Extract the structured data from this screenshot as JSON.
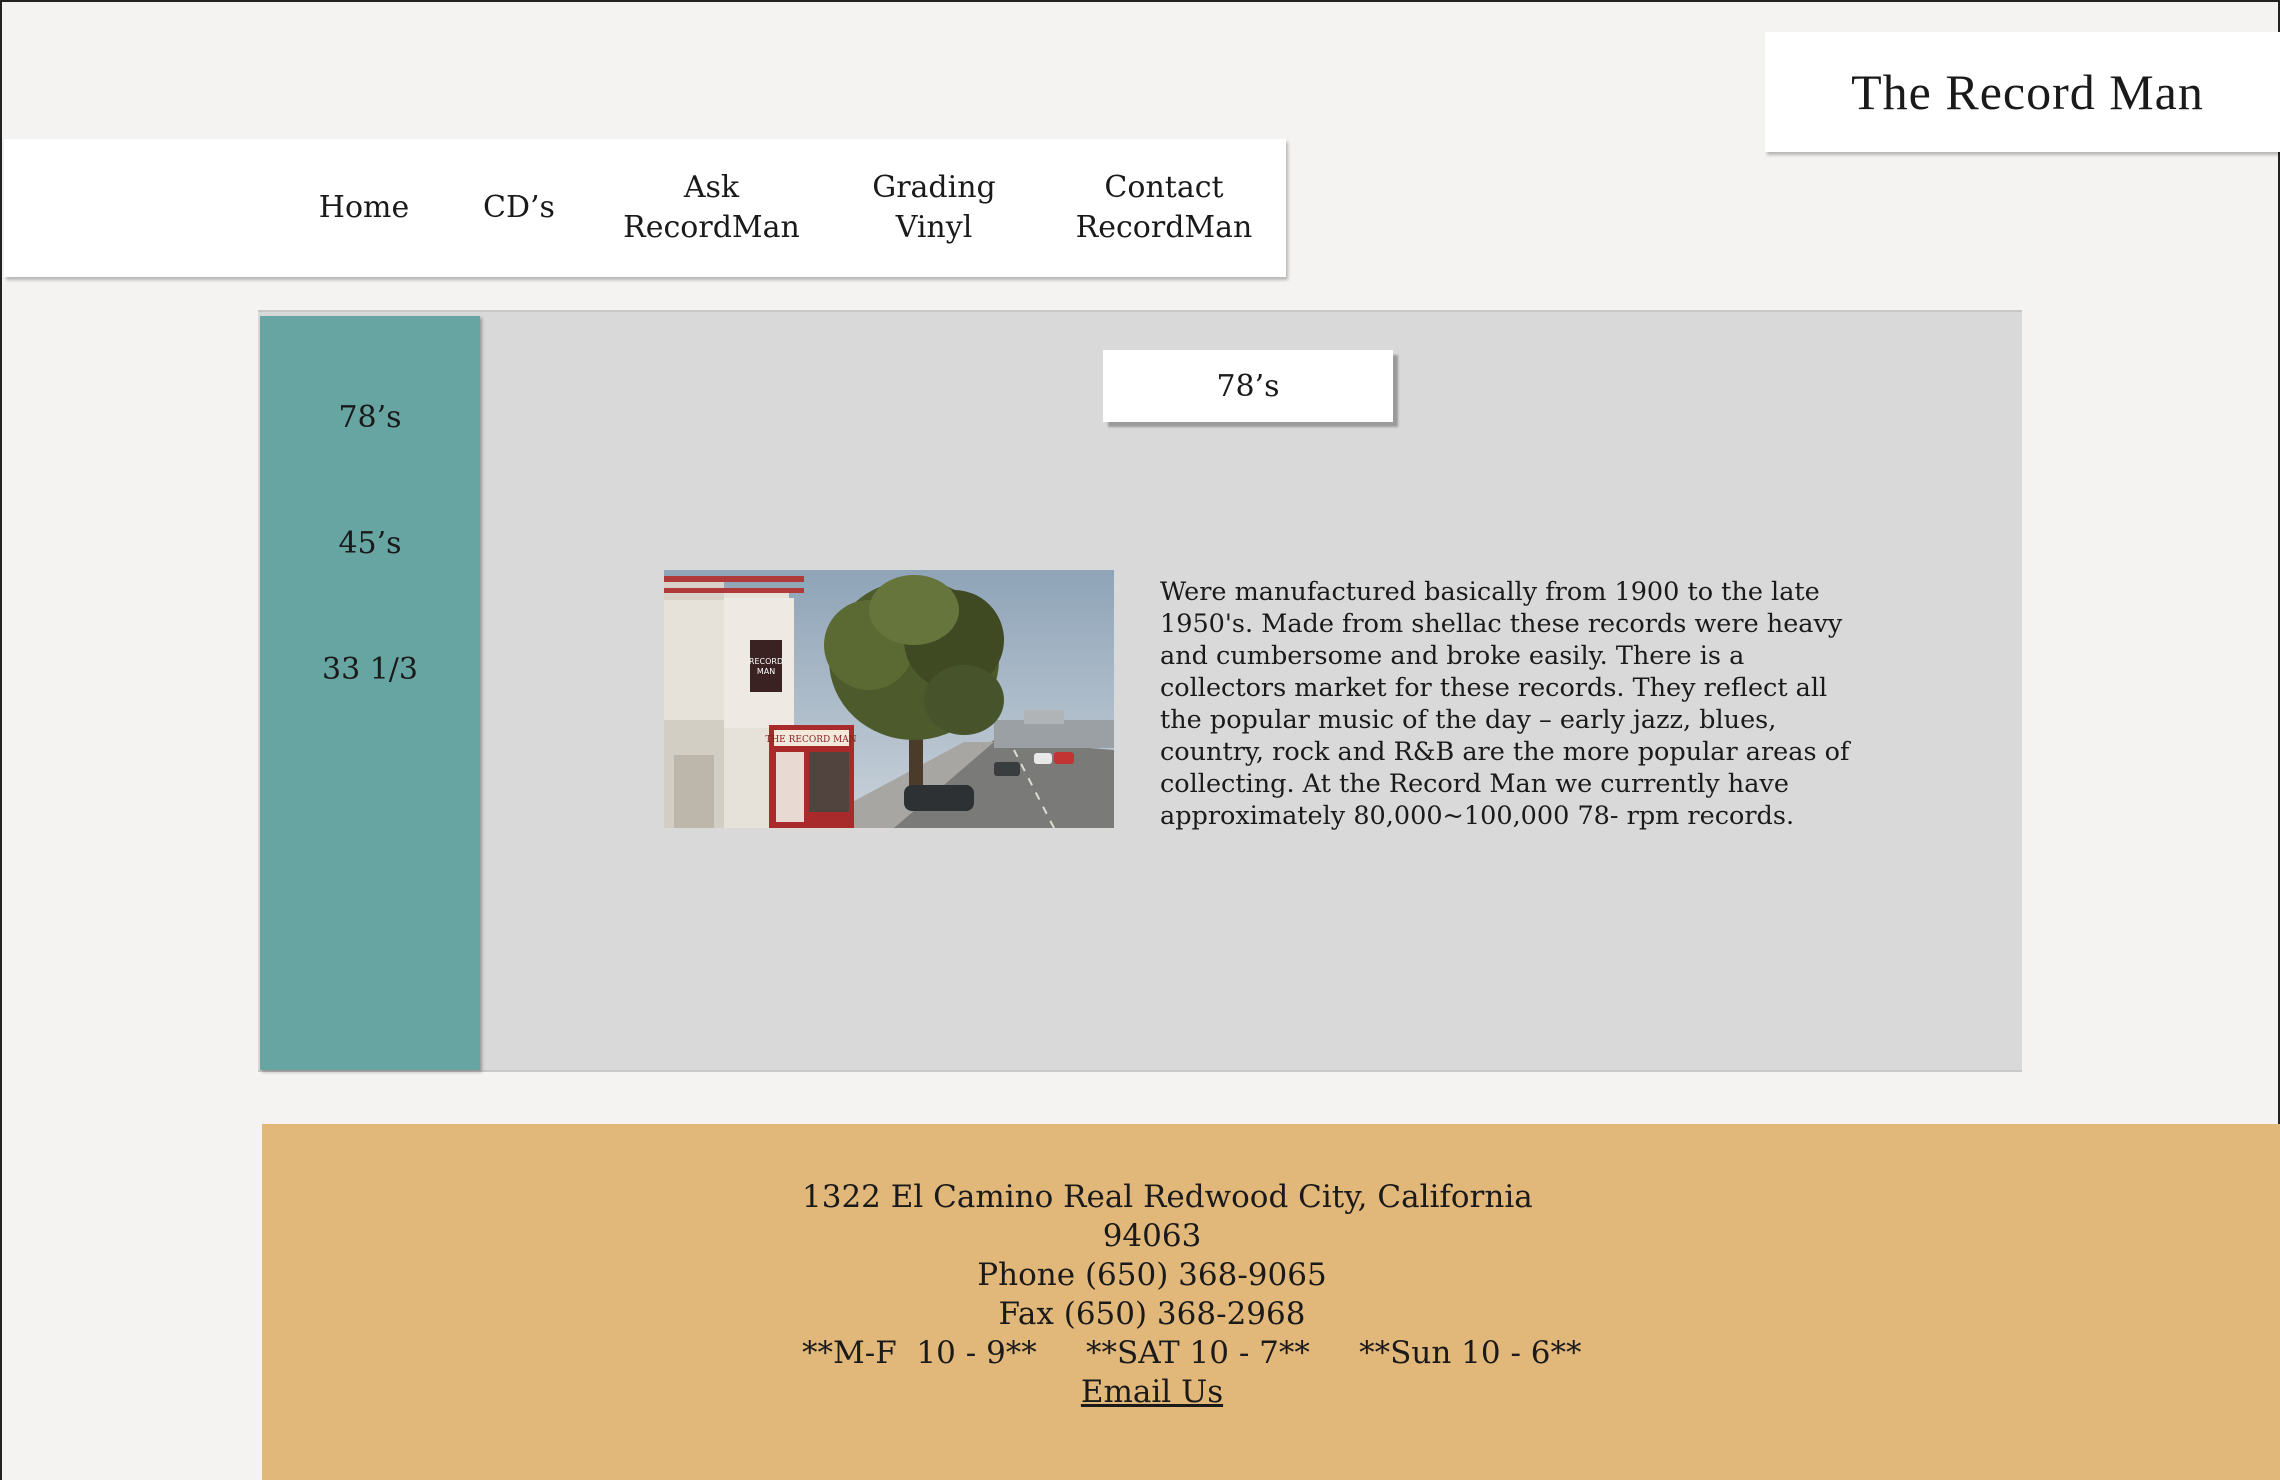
{
  "brand": {
    "title": "The Record Man"
  },
  "nav": {
    "items": [
      {
        "label": "Home"
      },
      {
        "label": "CD’s"
      },
      {
        "label": "Ask\nRecordMan"
      },
      {
        "label": "Grading\nVinyl"
      },
      {
        "label": "Contact\nRecordMan"
      }
    ]
  },
  "sidebar": {
    "items": [
      {
        "label": "78’s"
      },
      {
        "label": "45’s"
      },
      {
        "label": "33 1/3"
      }
    ]
  },
  "main": {
    "section_title": "78’s",
    "description": "Were manufactured basically from 1900 to the late 1950's.  Made from shellac these records were heavy and cumbersome and broke easily.  There is a collectors market for these records.  They reflect all the popular music of the day – early jazz, blues, country, rock and R&B are the more popular areas of collecting.  At the Record Man we currently have approximately 80,000~100,000 78- rpm records.",
    "photo": {
      "storefront_sign": "THE RECORD MAN",
      "side_logo": "RECORD MAN"
    }
  },
  "footer": {
    "address_line1": "1322 El Camino Real Redwood City, California",
    "address_line2": "94063",
    "phone": "Phone (650) 368-9065",
    "fax": "Fax (650) 368-2968",
    "hours": "**M-F  10 - 9**     **SAT 10 - 7**     **Sun 10 - 6**",
    "email_label": "Email Us"
  },
  "colors": {
    "page_bg": "#f4f3f1",
    "sidebar_teal": "#66a5a2",
    "panel_gray": "#d9d9d9",
    "footer_tan": "#e2b87a"
  }
}
